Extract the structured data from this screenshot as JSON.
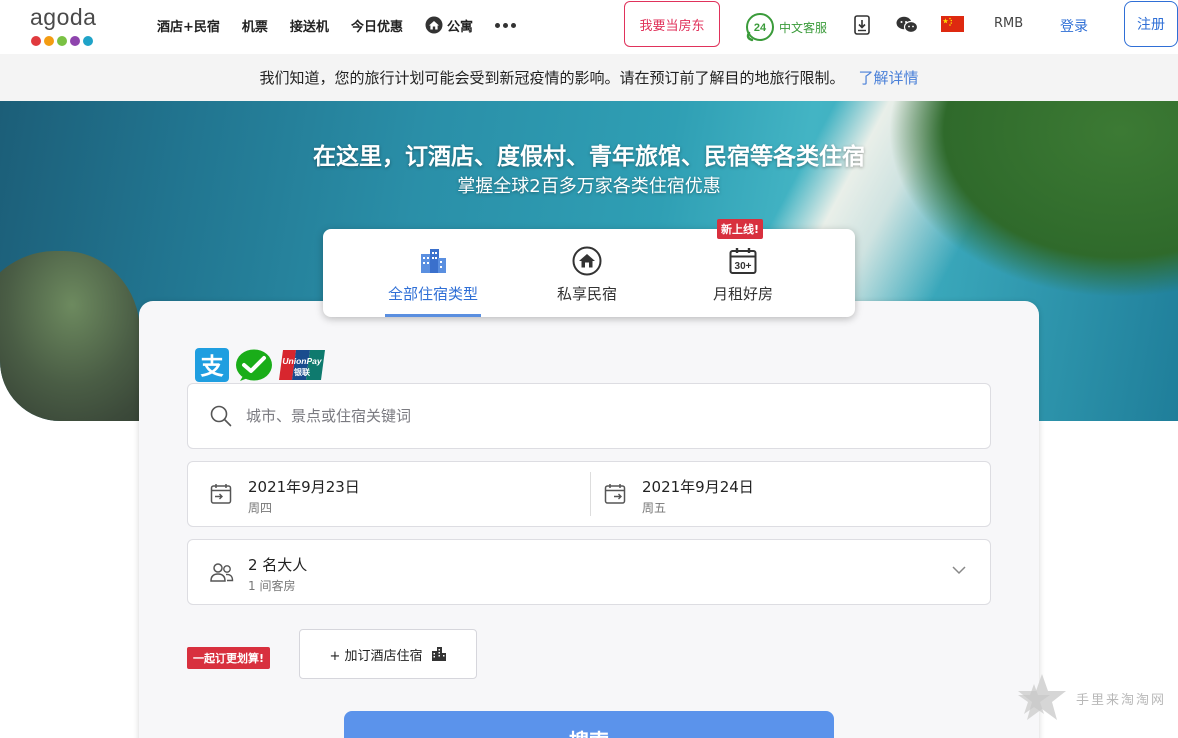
{
  "header": {
    "logo_text": "agoda",
    "logo_dot_colors": [
      "#e03a3e",
      "#f39c12",
      "#7ac143",
      "#8e44ad",
      "#1fa3c8"
    ],
    "nav": [
      {
        "label": "酒店+民宿"
      },
      {
        "label": "机票"
      },
      {
        "label": "接送机"
      },
      {
        "label": "今日优惠"
      },
      {
        "label": "公寓",
        "icon": "home-icon"
      }
    ],
    "more_icon": "more-dots-icon",
    "host_label": "我要当房东",
    "support_label": "中文客服",
    "support_icon": "phone-24-icon",
    "currency": "RMB",
    "login_label": "登录",
    "register_label": "注册",
    "colors": {
      "host": "#e0325b",
      "link": "#2f6fd6",
      "support": "#3a9b3a"
    }
  },
  "notice": {
    "text": "我们知道，您的旅行计划可能会受到新冠疫情的影响。请在预订前了解目的地旅行限制。",
    "link": "了解详情"
  },
  "hero": {
    "title": "在这里，订酒店、度假村、青年旅馆、民宿等各类住宿",
    "subtitle": "掌握全球2百多万家各类住宿优惠"
  },
  "tabs": [
    {
      "label": "全部住宿类型",
      "icon": "buildings-icon",
      "active": true
    },
    {
      "label": "私享民宿",
      "icon": "home-icon",
      "active": false
    },
    {
      "label": "月租好房",
      "icon": "calendar-30-icon",
      "active": false,
      "badge": "新上线!"
    }
  ],
  "payment_icons": [
    "alipay-icon",
    "wechat-pay-icon",
    "unionpay-icon"
  ],
  "unionpay_text": "UnionPay",
  "unionpay_cn": "银联",
  "search": {
    "placeholder": "城市、景点或住宿关键词"
  },
  "dates": {
    "checkin": {
      "date": "2021年9月23日",
      "weekday": "周四"
    },
    "checkout": {
      "date": "2021年9月24日",
      "weekday": "周五"
    }
  },
  "guests": {
    "main": "2 名大人",
    "sub": "1 间客房"
  },
  "deal_badge": "一起订更划算!",
  "addon_label": "+ 加订酒店住宿",
  "search_button": "搜索",
  "watermark": "手里来淘淘网",
  "accent_color": "#5b93eb"
}
